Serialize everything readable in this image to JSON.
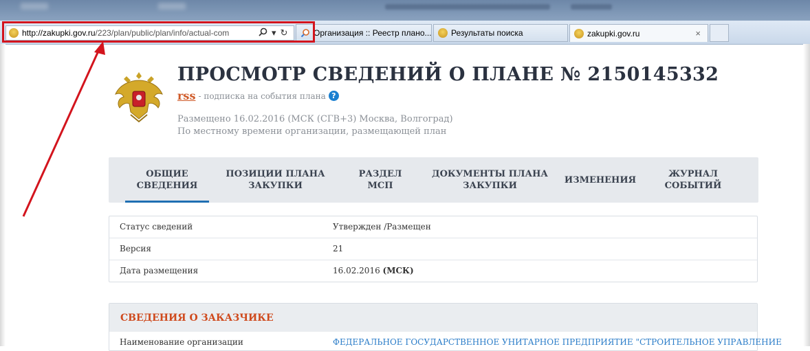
{
  "browser": {
    "url_host": "http://zakupki.gov.ru",
    "url_path": "/223/plan/public/plan/info/actual-com",
    "tabs": [
      {
        "label": "Организация :: Реестр плано..."
      },
      {
        "label": "Результаты поиска"
      },
      {
        "label": "zakupki.gov.ru",
        "close": "×"
      }
    ]
  },
  "page": {
    "title": "ПРОСМОТР СВЕДЕНИЙ О ПЛАНЕ № 2150145332",
    "rss_label": "rss",
    "rss_subscribe": "- подписка на события плана",
    "help": "?",
    "posted_line1": "Размещено 16.02.2016 (МСК (СГВ+3) Москва, Волгоград)",
    "posted_line2": "По местному времени организации, размещающей план"
  },
  "nav": {
    "tabs": [
      {
        "line1": "ОБЩИЕ",
        "line2": "СВЕДЕНИЯ"
      },
      {
        "line1": "ПОЗИЦИИ ПЛАНА",
        "line2": "ЗАКУПКИ"
      },
      {
        "line1": "РАЗДЕЛ",
        "line2": "МСП"
      },
      {
        "line1": "ДОКУМЕНТЫ ПЛАНА",
        "line2": "ЗАКУПКИ"
      },
      {
        "line1": "ИЗМЕНЕНИЯ",
        "line2": ""
      },
      {
        "line1": "ЖУРНАЛ",
        "line2": "СОБЫТИЙ"
      }
    ]
  },
  "info": {
    "rows": [
      {
        "key": "Статус сведений",
        "value": "Утвержден /Размещен"
      },
      {
        "key": "Версия",
        "value": "21"
      },
      {
        "key": "Дата размещения",
        "value": "16.02.2016",
        "value_suffix": "(МСК)"
      }
    ]
  },
  "customer": {
    "heading": "СВЕДЕНИЯ О ЗАКАЗЧИКЕ",
    "org_key": "Наименование организации",
    "org_value": "ФЕДЕРАЛЬНОЕ ГОСУДАРСТВЕННОЕ УНИТАРНОЕ ПРЕДПРИЯТИЕ \"СТРОИТЕЛЬНОЕ УПРАВЛЕНИЕ"
  },
  "colors": {
    "highlight": "#d3141d",
    "accent_blue": "#1f6fb2",
    "section_heading": "#cf4a1d",
    "link": "#2a7cc8"
  }
}
